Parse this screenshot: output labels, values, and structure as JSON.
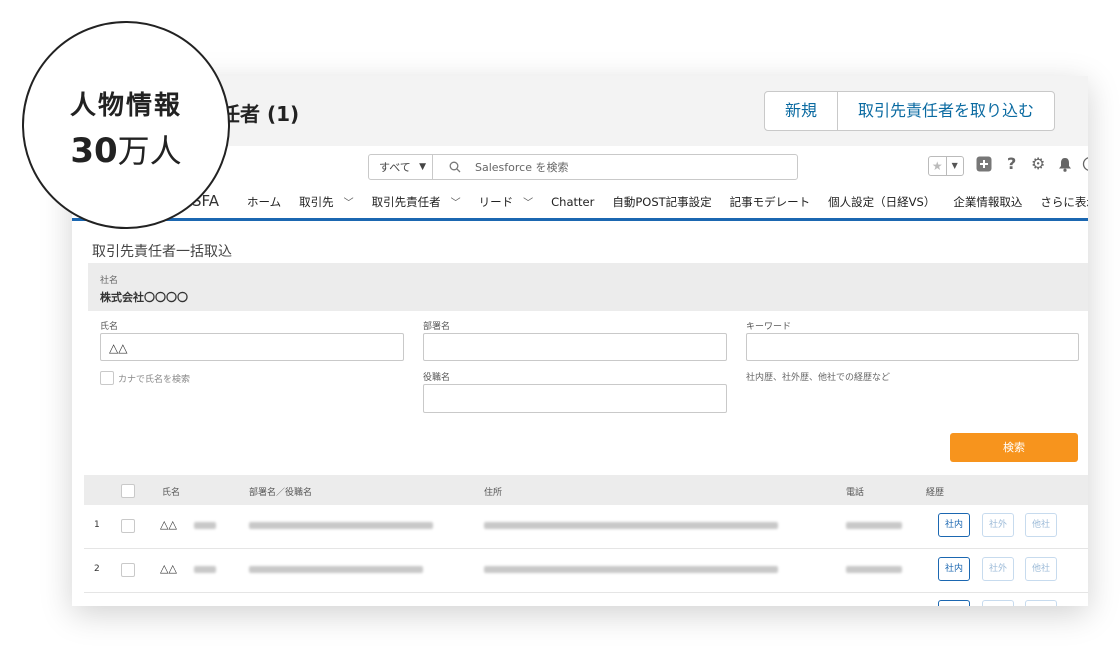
{
  "badge": {
    "line1": "人物情報",
    "number": "30",
    "unit": "万人"
  },
  "header": {
    "title": "任者 (1)",
    "new_button": "新規",
    "import_button": "取引先責任者を取り込む"
  },
  "globalbar": {
    "scope": "すべて",
    "search_placeholder": "Salesforce を検索"
  },
  "app_name": "SFA",
  "nav": [
    "ホーム",
    "取引先",
    "取引先責任者",
    "リード",
    "Chatter",
    "自動POST記事設定",
    "記事モデレート",
    "個人設定（日経VS）",
    "企業情報取込",
    "さらに表示"
  ],
  "form": {
    "title": "取引先責任者一括取込",
    "company_label": "社名",
    "company_value": "株式会社〇〇〇〇",
    "name_label": "氏名",
    "name_value": "△△",
    "dept_label": "部署名",
    "keyword_label": "キーワード",
    "kana_label": "カナで氏名を検索",
    "title_label": "役職名",
    "keyword_hint": "社内歴、社外歴、他社での経歴など",
    "search_button": "検索"
  },
  "table": {
    "headers": [
      "氏名",
      "部署名／役職名",
      "住所",
      "電話",
      "経歴"
    ],
    "rows": [
      {
        "index": "1",
        "name": "△△"
      },
      {
        "index": "2",
        "name": "△△"
      }
    ],
    "tags": [
      "社内",
      "社外",
      "他社"
    ]
  },
  "colors": {
    "accent": "#1b67b1",
    "search_button": "#f7941d"
  }
}
